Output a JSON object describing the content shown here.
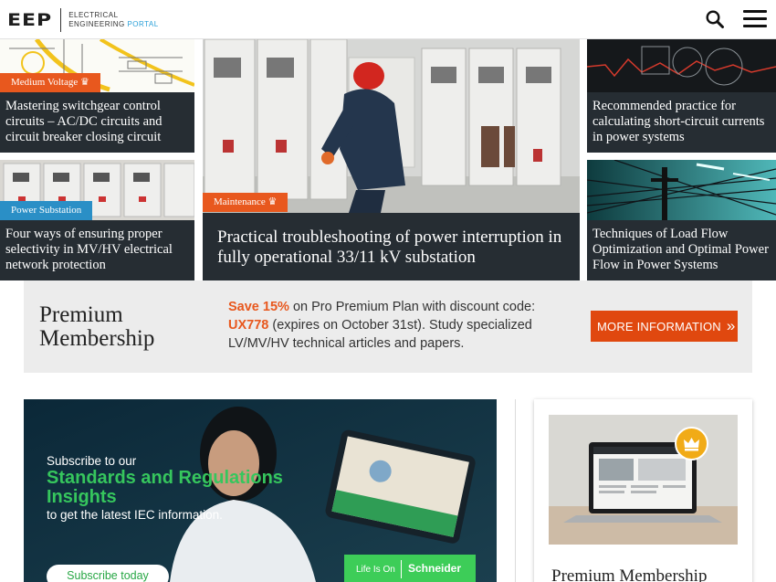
{
  "header": {
    "logo_mark": "EEP",
    "logo_line1": "Electrical",
    "logo_line2": "Engineering",
    "logo_line3": "Portal",
    "search_icon": "search-icon",
    "menu_icon": "hamburger-menu-icon"
  },
  "articles": [
    {
      "tag": "Medium Voltage ♛",
      "title": "Mastering switchgear control circuits – AC/DC circuits and circuit breaker closing circuit"
    },
    {
      "tag": "Power Substation",
      "title": "Four ways of ensuring proper selectivity in MV/HV electrical network protection"
    },
    {
      "tag": "Maintenance ♛",
      "title": "Practical troubleshooting of power interruption in fully operational 33/11 kV substation"
    },
    {
      "title": "Recommended practice for calculating short-circuit currents in power systems"
    },
    {
      "title": "Techniques of Load Flow Optimization and Optimal Power Flow in Power Systems"
    }
  ],
  "premium": {
    "title_line1": "Premium",
    "title_line2": "Membership",
    "save": "Save 15%",
    "text1": " on Pro Premium Plan with discount code: ",
    "code": "UX778",
    "text2": " (expires on October 31st). Study specialized LV/MV/HV technical articles and papers.",
    "button": "MORE INFORMATION",
    "button_chevron": "»"
  },
  "banner": {
    "line1": "Subscribe to our",
    "line2": "Standards and Regulations Insights",
    "line3": "to get the latest IEC information.",
    "button": "Subscribe today",
    "life_is_on": "Life Is On",
    "brand": "Schneider"
  },
  "card": {
    "title": "Premium Membership",
    "badge_icon": "crown-icon"
  },
  "colors": {
    "accent_orange": "#e8581e",
    "tag_blue": "#2a8fc6",
    "caption_dark": "#262d33",
    "schneider_green": "#3dcd58"
  }
}
